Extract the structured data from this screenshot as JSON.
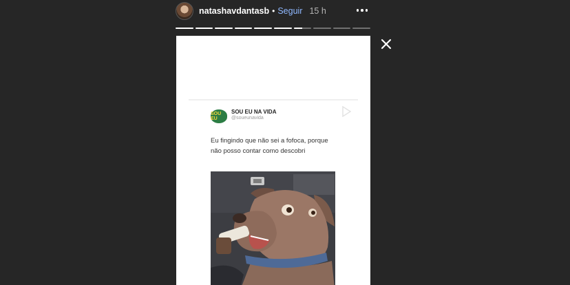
{
  "header": {
    "username": "natashavdantasb",
    "separator": "•",
    "follow_label": "Seguir",
    "time": "15 h",
    "more_icon": "more-horizontal-icon"
  },
  "progress": {
    "segments": 10,
    "completed": 6,
    "current_fraction": 0.5
  },
  "close_icon": "close-icon",
  "tweet": {
    "account_name": "SOU EU NA VIDA",
    "handle": "@soueunavida",
    "badge_text": "SOU EU",
    "text": "Eu fingindo que não sei a fofoca, porque não posso contar como descobri"
  },
  "colors": {
    "background": "#262626",
    "follow": "#8fb8ff",
    "story_card": "#ffffff"
  }
}
